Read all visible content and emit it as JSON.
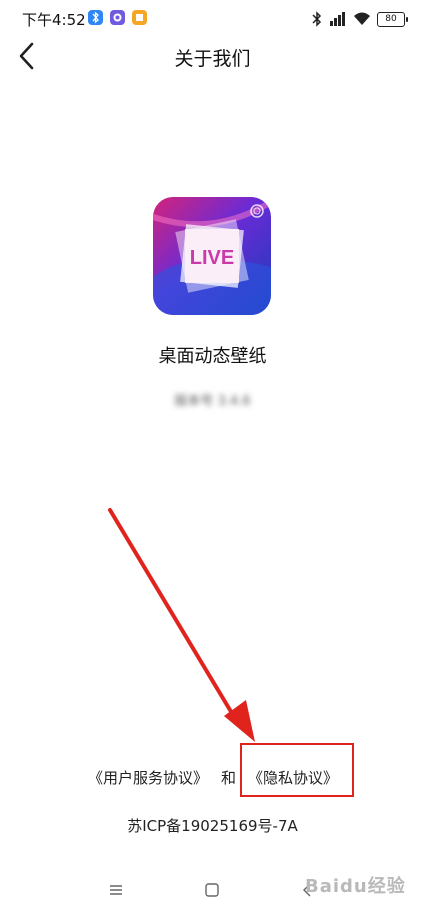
{
  "status_bar": {
    "time": "下午4:52",
    "battery": "80"
  },
  "header": {
    "title": "关于我们"
  },
  "app": {
    "icon_text": "LIVE",
    "name": "桌面动态壁纸",
    "version": "版本号 3.4.6"
  },
  "agreements": {
    "user_agreement": "《用户服务协议》",
    "and": "和",
    "privacy_policy": "《隐私协议》"
  },
  "icp": "苏ICP备19025169号-7A",
  "watermark": "Baidu经验",
  "colors": {
    "annotation_red": "#e0231c",
    "background": "#ffffff"
  },
  "icons": [
    "back-arrow-icon",
    "bluetooth-icon",
    "signal-icon",
    "wifi-icon",
    "battery-icon",
    "menu-icon",
    "home-icon",
    "nav-back-icon"
  ]
}
